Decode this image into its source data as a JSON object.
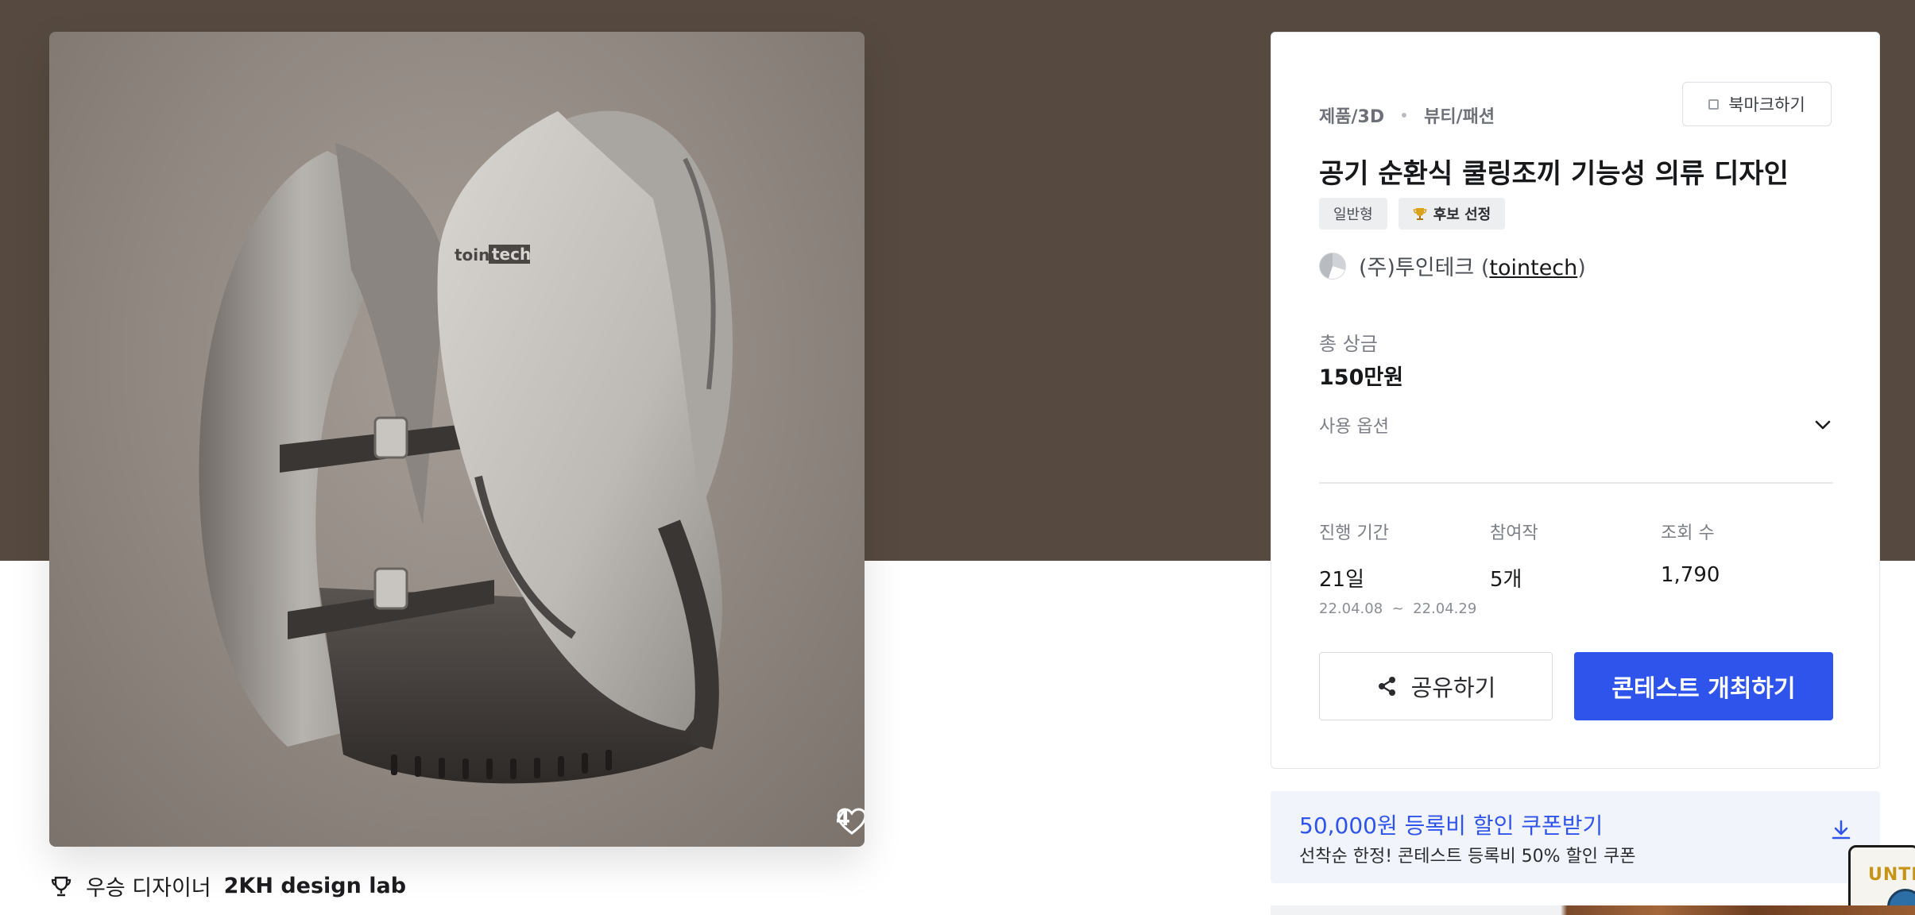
{
  "product": {
    "like_count": "4",
    "winner_prefix": "우승 디자이너",
    "winner_name": "2KH design lab"
  },
  "card": {
    "breadcrumb": [
      "제품/3D",
      "뷰티/패션"
    ],
    "bookmark_label": "북마크하기",
    "title": "공기 순환식 쿨링조끼 기능성 의류 디자인",
    "badges": {
      "type": "일반형",
      "status": "후보 선정"
    },
    "host": {
      "name_prefix": "(주)투인테크 (",
      "id": "tointech",
      "name_suffix": ")"
    },
    "prize": {
      "label": "총 상금",
      "value": "150만원"
    },
    "options_label": "사용 옵션",
    "stats": {
      "period": {
        "label": "진행 기간",
        "value": "21일",
        "range": "22.04.08  ~  22.04.29"
      },
      "entries": {
        "label": "참여작",
        "value": "5개"
      },
      "views": {
        "label": "조회 수",
        "value": "1,790"
      }
    },
    "share_label": "공유하기",
    "host_button_label": "콘테스트 개최하기"
  },
  "coupon": {
    "headline": "50,000원 등록비 할인 쿠폰받기",
    "description": "선착순 한정! 콘테스트 등록비 50% 할인 쿠폰"
  },
  "thumb": {
    "text": "UNTI"
  },
  "colors": {
    "hero": "#564a40",
    "accent": "#2f54eb",
    "coupon_bg": "#f2f4fb"
  },
  "icons": [
    "heart-icon",
    "trophy-icon",
    "bookmark-icon",
    "chevron-down-icon",
    "share-icon",
    "download-icon"
  ]
}
